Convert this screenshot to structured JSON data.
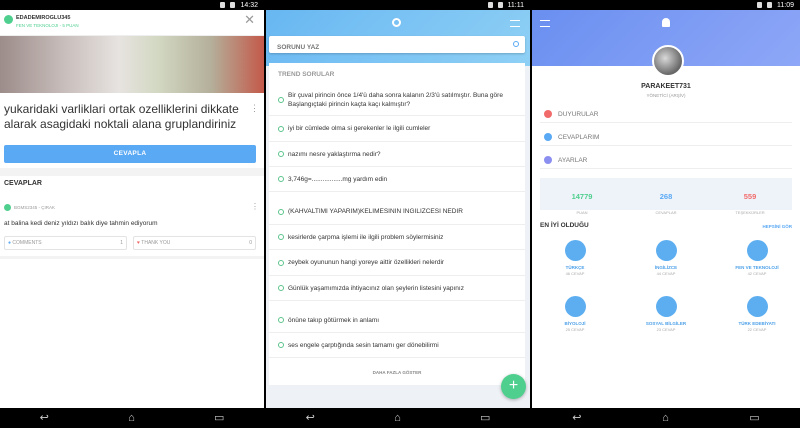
{
  "panel1": {
    "status_time": "14:32",
    "username": "EDADEMIROGLU345",
    "subject_points": "FEN VE TEKNOLOJI - 5 PUAN",
    "question": "yukaridaki varliklari ortak ozelliklerini dikkate alarak asagidaki noktali alana gruplandiriniz",
    "answer_button": "CEVAPLA",
    "answers_title": "CEVAPLAR",
    "answerer": "BGMS2345 - ÇIRAK",
    "answer_text": "at balina kedi deniz yıldızı balık diye tahmin ediyorum",
    "comments_label": "COMMENTS",
    "comments_count": "1",
    "thank_label": "THANK YOU",
    "thank_count": "0"
  },
  "panel2": {
    "status_time": "11:11",
    "search_placeholder": "SORUNU YAZ",
    "trend_title": "TREND SORULAR",
    "questions": [
      "Bir çuval pirincin önce 1/4'ü daha sonra kalanın 2/3'ü satılmıştır. Buna göre Başlangıçtaki pirincin kaçta kaçı kalmıştır?",
      "iyi bir cümlede olma si gerekenler le ilgili cumleler",
      "nazımı nesre yaklaştırma nedir?",
      "3,746g=.................mg yardım edin",
      "(KAHVALTIMI YAPARIM)KELIMESININ INGILIZCESI NEDIR",
      "kesirlerde çarpma işlemi ile ilgili problem söylermisiniz",
      "zeybek oyununun hangi yoreye aittir özellikleri nelerdir",
      "Günlük yaşamımızda ihtiyacınız olan şeylerin listesini yapınız",
      "önüne takıp götürmek in anlamı",
      "ses engele çarptığında sesin tamamı ger dönebilirmi"
    ],
    "more_button": "DAHA FAZLA GÖSTER",
    "fab_symbol": "+"
  },
  "panel3": {
    "status_time": "11:09",
    "username": "PARAKEET731",
    "rank": "YÖNETİCİ (ARŞİV)",
    "menu": [
      "DUYURULAR",
      "CEVAPLARIM",
      "AYARLAR"
    ],
    "stats": [
      {
        "value": "14779",
        "label": "PUAN",
        "color": "#4ecf8e"
      },
      {
        "value": "268",
        "label": "CEVAPLAR",
        "color": "#5aa9f4"
      },
      {
        "value": "559",
        "label": "TEŞEKKÜRLER",
        "color": "#f26b6b"
      }
    ],
    "best_title": "EN İYİ OLDUĞU",
    "see_all": "HEPSİNİ GÖR",
    "subjects": [
      {
        "name": "TÜRKÇE",
        "count": "46 CEVAP"
      },
      {
        "name": "İNGİLİZCE",
        "count": "44 CEVAP"
      },
      {
        "name": "FEN VE TEKNOLOJİ",
        "count": "42 CEVAP"
      },
      {
        "name": "BİYOLOJİ",
        "count": "25 CEVAP"
      },
      {
        "name": "SOSYAL BİLGİLER",
        "count": "23 CEVAP"
      },
      {
        "name": "TÜRK EDEBİYATI",
        "count": "22 CEVAP"
      }
    ]
  }
}
